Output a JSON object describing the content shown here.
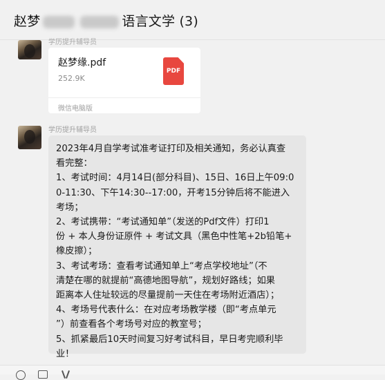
{
  "header": {
    "title_start": "赵梦",
    "title_end": "语言文学 (3)"
  },
  "messages": {
    "top_sender_partial": "学历提升辅导员",
    "file": {
      "name": "赵梦缘.pdf",
      "size": "252.9K",
      "type_label": "PDF",
      "source": "微信电脑版"
    },
    "sender": "学历提升辅导员",
    "text_lines": [
      "2023年4月自学考试准考证打印及相关通知，务必认真查",
      "看完整：",
      "1、考试时间：4月14日(部分科目)、15日、16日上午09:0",
      "0-11:30、下午14:30--17:00，开考15分钟后将不能进入",
      "考场；",
      "2、考试携带：“考试通知单”（发送的Pdf文件）打印1",
      "份 + 本人身份证原件 + 考试文具（黑色中性笔+2b铅笔+",
      "橡皮擦）；",
      "3、考试考场：查看考试通知单上“考点学校地址”（不",
      "清楚在哪的就提前“高德地图导航”，规划好路线；如果",
      "距离本人住址较远的尽量提前一天住在考场附近酒店）；",
      "4、考场号代表什么：在对应考场教学楼（即“考点单元",
      "”）前查看各个考场号对应的教室号；",
      "5、抓紧最后10天时间复习好考试科目，早日考完顺利毕",
      "业！"
    ]
  },
  "toolbar": {
    "icons": [
      "emoji-icon",
      "folder-icon",
      "scissors-icon"
    ]
  }
}
